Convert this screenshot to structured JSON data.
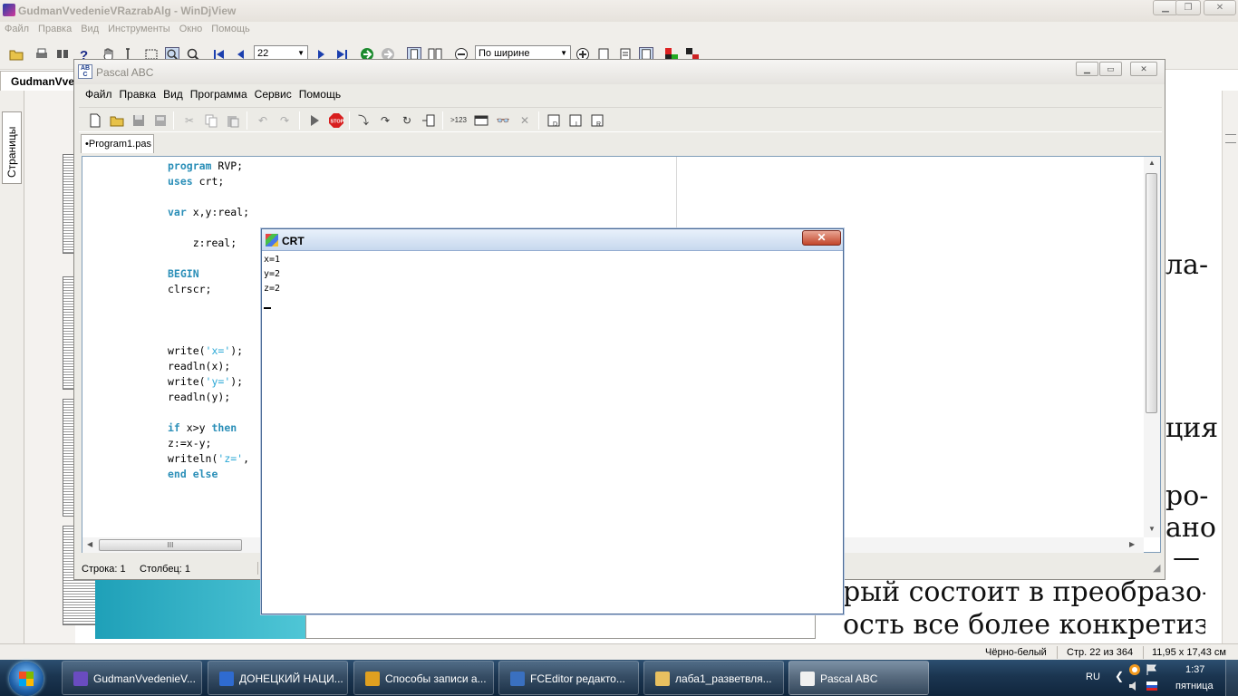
{
  "windjview": {
    "title": "GudmanVvedenieVRazrabAlg - WinDjView",
    "menu": [
      "Файл",
      "Правка",
      "Вид",
      "Инструменты",
      "Окно",
      "Помощь"
    ],
    "page_number": "22",
    "zoom": "По ширине",
    "doc_tab": "GudmanVvedenieVRazrabAlg",
    "sidebar_tab": "Страницы",
    "page_fragments": [
      "ла-",
      "ция",
      "ро-",
      "ано",
      "—"
    ],
    "bottom_lines": [
      "рый состоит в преобразо-",
      "ость все более конкретизи-"
    ],
    "status": {
      "mode": "Чёрно-белый",
      "page": "Стр. 22 из 364",
      "size": "11,95 x 17,43 см"
    },
    "icons": [
      "open-icon",
      "print-icon",
      "find-icon",
      "help-icon",
      "hand-icon",
      "select-text-icon",
      "select-rect-icon",
      "zoom-icon",
      "zoom-rect-icon",
      "first-page-icon",
      "prev-page-icon",
      "next-page-icon",
      "last-page-icon",
      "back-icon",
      "forward-icon",
      "single-page-icon",
      "facing-pages-icon",
      "zoom-out-icon",
      "zoom-in-icon",
      "fit-page-icon",
      "actual-size-icon",
      "rotate-icon",
      "color-mode-icon"
    ]
  },
  "pascal": {
    "title": "Pascal ABC",
    "menu": [
      "Файл",
      "Правка",
      "Вид",
      "Программа",
      "Сервис",
      "Помощь"
    ],
    "tab": "•Program1.pas",
    "code_lines": [
      [
        {
          "t": "program",
          "c": "kw"
        },
        {
          "t": " RVP;",
          "c": ""
        }
      ],
      [
        {
          "t": "uses",
          "c": "kw"
        },
        {
          "t": " crt;",
          "c": ""
        }
      ],
      [],
      [
        {
          "t": "var",
          "c": "kw"
        },
        {
          "t": " x,y:real;",
          "c": ""
        }
      ],
      [],
      [
        {
          "t": "    z:real;",
          "c": ""
        }
      ],
      [],
      [
        {
          "t": "BEGIN",
          "c": "kw"
        }
      ],
      [
        {
          "t": "clrscr;",
          "c": ""
        }
      ],
      [],
      [],
      [],
      [
        {
          "t": "write(",
          "c": ""
        },
        {
          "t": "'x='",
          "c": "str"
        },
        {
          "t": ");",
          "c": ""
        }
      ],
      [
        {
          "t": "readln(x);",
          "c": ""
        }
      ],
      [
        {
          "t": "write(",
          "c": ""
        },
        {
          "t": "'y='",
          "c": "str"
        },
        {
          "t": ");",
          "c": ""
        }
      ],
      [
        {
          "t": "readln(y);",
          "c": ""
        }
      ],
      [],
      [
        {
          "t": "if",
          "c": "kw"
        },
        {
          "t": " x>y ",
          "c": ""
        },
        {
          "t": "then",
          "c": "kw"
        }
      ],
      [
        {
          "t": "z:=x-y;",
          "c": ""
        }
      ],
      [
        {
          "t": "writeln(",
          "c": ""
        },
        {
          "t": "'z='",
          "c": "str"
        },
        {
          "t": ",",
          "c": ""
        }
      ],
      [
        {
          "t": "end else",
          "c": "kw"
        }
      ]
    ],
    "status_row": "Строка: 1",
    "status_col": "Столбец: 1",
    "hscroll_grip": "III"
  },
  "crt": {
    "title": "CRT",
    "close": "✕",
    "output": "x=1\ny=2\nz=2"
  },
  "taskbar": {
    "items": [
      {
        "label": "GudmanVvedenieV...",
        "icon": "windjview-icon",
        "color": "#6a4cc0"
      },
      {
        "label": "ДОНЕЦКИЙ НАЦИ...",
        "icon": "word-icon",
        "color": "#2f6bd0"
      },
      {
        "label": "Способы записи а...",
        "icon": "chrome-icon",
        "color": "#e0a020"
      },
      {
        "label": "FCEditor редакто...",
        "icon": "fceditor-icon",
        "color": "#3a70c0"
      },
      {
        "label": "лаба1_разветвля...",
        "icon": "folder-icon",
        "color": "#e8c060"
      },
      {
        "label": "Pascal ABC",
        "icon": "pascal-abc-icon",
        "color": "#f0f0f0"
      }
    ],
    "lang": "RU",
    "time": "1:37",
    "day": "пятница"
  }
}
